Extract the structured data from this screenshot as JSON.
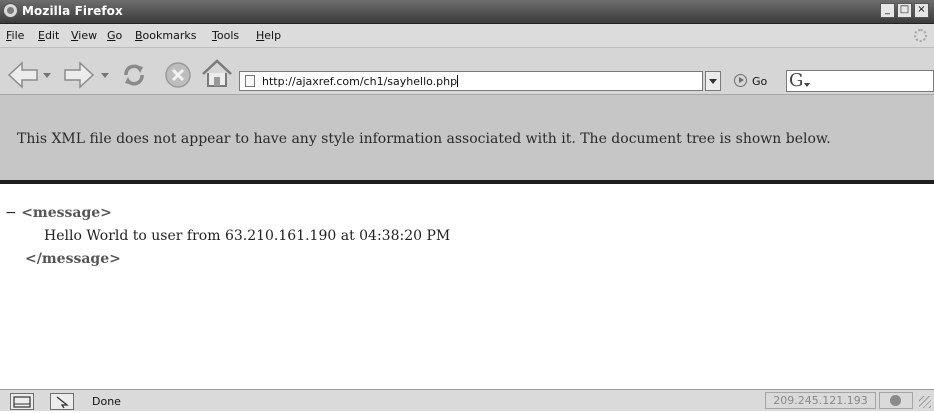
{
  "window": {
    "title": "Mozilla Firefox",
    "minimize_label": "_",
    "maximize_label": "□",
    "close_label": "×"
  },
  "menu": {
    "items": [
      {
        "label": "File",
        "key": "F",
        "rest": "ile"
      },
      {
        "label": "Edit",
        "key": "E",
        "rest": "dit"
      },
      {
        "label": "View",
        "key": "V",
        "rest": "iew"
      },
      {
        "label": "Go",
        "key": "G",
        "rest": "o"
      },
      {
        "label": "Bookmarks",
        "key": "B",
        "rest": "ookmarks"
      },
      {
        "label": "Tools",
        "key": "T",
        "rest": "ools"
      },
      {
        "label": "Help",
        "key": "H",
        "rest": "elp"
      }
    ]
  },
  "toolbar": {
    "url": "http://ajaxref.com/ch1/sayhello.php",
    "go_label": "Go",
    "search_placeholder": ""
  },
  "banner": {
    "text": "This XML file does not appear to have any style information associated with it. The document tree is shown below."
  },
  "xml": {
    "collapse_marker": "−",
    "open_tag": "<message>",
    "text": "Hello World to user from 63.210.161.190 at 04:38:20 PM",
    "close_tag": "</message>"
  },
  "status": {
    "text": "Done",
    "ip": "209.245.121.193"
  }
}
